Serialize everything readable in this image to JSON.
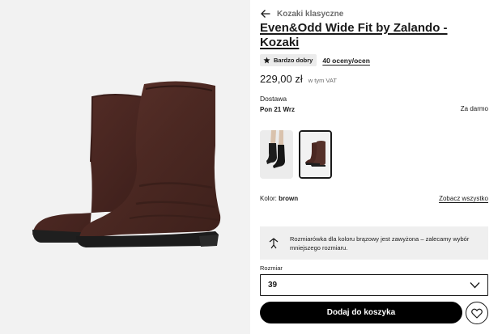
{
  "product": {
    "breadcrumb": "Kozaki klasyczne",
    "title": "Even&Odd Wide Fit by Zalando - Kozaki",
    "rating_badge": "Bardzo dobry",
    "reviews_link": "40 oceny/ocen",
    "price": "229,00 zł",
    "vat_note": "w tym VAT"
  },
  "delivery": {
    "label": "Dostawa",
    "date": "Pon 21 Wrz",
    "cost": "Za darmo"
  },
  "color": {
    "label": "Kolor:",
    "value": "brown",
    "see_all": "Zobacz wszystko"
  },
  "swatches": [
    {
      "name": "black",
      "selected": false
    },
    {
      "name": "brown",
      "selected": true
    }
  ],
  "size_notice": "Rozmiarówka dla koloru brązowy jest zawyżona – zalecamy wybór mniejszego rozmiaru.",
  "size": {
    "label": "Rozmiar",
    "selected": "39"
  },
  "actions": {
    "add_to_cart": "Dodaj do koszyka"
  },
  "colors": {
    "boot_brown": "#4a2721",
    "gallery_bg": "#f2f2f2",
    "notice_bg": "#efefef",
    "button_bg": "#000000"
  },
  "icons": {
    "back": "arrow-left-icon",
    "star": "star-icon",
    "ruler": "ruler-icon",
    "chevron": "chevron-down-icon",
    "wishlist": "heart-icon"
  }
}
